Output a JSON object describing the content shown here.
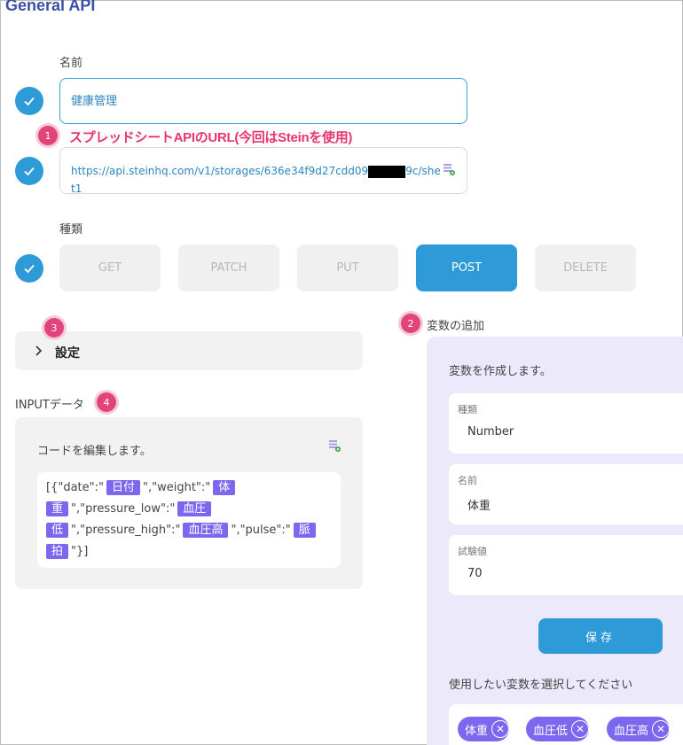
{
  "app": {
    "title": "General API"
  },
  "name_field": {
    "label": "名前",
    "value": "健康管理"
  },
  "url_field": {
    "value_line1": "https://api.steinhq.com/v1/storages/636e34f9d27cdd09",
    "value_tail": "9c/she",
    "value_line2": "t1"
  },
  "type_field": {
    "label": "種類"
  },
  "methods": [
    "GET",
    "PATCH",
    "PUT",
    "POST",
    "DELETE"
  ],
  "active_method": "POST",
  "annotations": {
    "a1": {
      "num": "1",
      "text": "スプレッドシートAPIのURL(今回はSteinを使用)"
    },
    "a2": {
      "num": "2"
    },
    "a3": {
      "num": "3"
    },
    "a4": {
      "num": "4"
    }
  },
  "settings": {
    "label": "設定"
  },
  "input_data": {
    "label": "INPUTデータ",
    "hint": "コードを編集します。",
    "code": {
      "p1": "[{\"date\":\"",
      "t1": "日付",
      "p2": "\",\"weight\":\"",
      "t2a": "体",
      "t2b": "重",
      "p3": "\",\"pressure_low\":\"",
      "t3a": "血圧",
      "t3b": "低",
      "p4": "\",\"pressure_high\":\"",
      "t4": "血圧高",
      "p5": "\",\"pulse\":\"",
      "t5a": "脈",
      "t5b": "拍",
      "p6": "\"}]"
    }
  },
  "variables": {
    "title": "変数の追加",
    "create_hint": "変数を作成します。",
    "type_label": "種類",
    "type_value": "Number",
    "name_label": "名前",
    "name_value": "体重",
    "test_label": "試験値",
    "test_value": "70",
    "save_label": "保存",
    "select_hint": "使用したい変数を選択してください",
    "chips": [
      "体重",
      "血圧低",
      "血圧高"
    ]
  },
  "colors": {
    "accent": "#2f9ad8",
    "tag": "#7b68ee",
    "annotation": "#e8336f",
    "brand": "#3b4ea8"
  }
}
